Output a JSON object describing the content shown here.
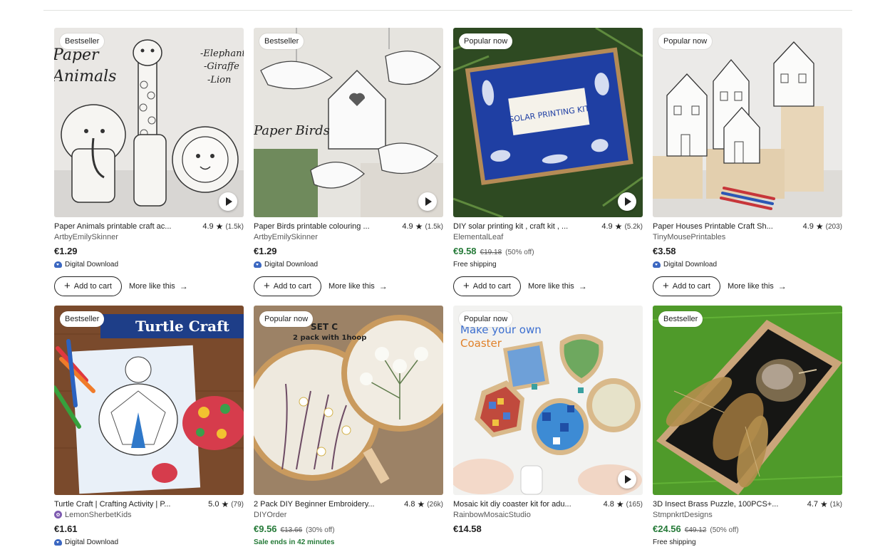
{
  "listings": [
    {
      "badge": "Bestseller",
      "title": "Paper Animals printable craft ac...",
      "rating": "4.9",
      "reviews": "(1.5k)",
      "shop": "ArtbyEmilySkinner",
      "price": "€1.29",
      "original_price": "",
      "discount": "",
      "note": "Digital Download",
      "image_text": [
        "Paper",
        "Animals",
        "-Elephant",
        "-Giraffe",
        "-Lion"
      ]
    },
    {
      "badge": "Bestseller",
      "title": "Paper Birds printable colouring ...",
      "rating": "4.9",
      "reviews": "(1.5k)",
      "shop": "ArtbyEmilySkinner",
      "price": "€1.29",
      "original_price": "",
      "discount": "",
      "note": "Digital Download",
      "image_text": [
        "Paper Birds"
      ]
    },
    {
      "badge": "Popular now",
      "title": "DIY solar printing kit , craft kit , ...",
      "rating": "4.9",
      "reviews": "(5.2k)",
      "shop": "ElementalLeaf",
      "price": "€9.58",
      "original_price": "€19.18",
      "discount": "(50% off)",
      "note": "Free shipping",
      "image_text": [
        "SOLAR PRINTING KIT"
      ]
    },
    {
      "badge": "Popular now",
      "title": "Paper Houses Printable Craft Sh...",
      "rating": "4.9",
      "reviews": "(203)",
      "shop": "TinyMousePrintables",
      "price": "€3.58",
      "original_price": "",
      "discount": "",
      "note": "Digital Download",
      "image_text": []
    },
    {
      "badge": "Bestseller",
      "title": "Turtle Craft | Crafting Activity | P...",
      "rating": "5.0",
      "reviews": "(79)",
      "shop": "LemonSherbetKids",
      "price": "€1.61",
      "original_price": "",
      "discount": "",
      "note": "Digital Download",
      "image_text": [
        "Turtle Craft"
      ]
    },
    {
      "badge": "Popular now",
      "title": "2 Pack DIY Beginner Embroidery...",
      "rating": "4.8",
      "reviews": "(26k)",
      "shop": "DIYOrder",
      "price": "€9.56",
      "original_price": "€13.66",
      "discount": "(30% off)",
      "note": "Sale ends in 42 minutes",
      "image_text": [
        "SET C",
        "2 pack with 1hoop"
      ]
    },
    {
      "badge": "Popular now",
      "title": "Mosaic kit diy coaster kit for adu...",
      "rating": "4.8",
      "reviews": "(165)",
      "shop": "RainbowMosaicStudio",
      "price": "€14.58",
      "original_price": "",
      "discount": "",
      "note": "",
      "image_text": [
        "Make your own",
        "Coaster"
      ]
    },
    {
      "badge": "Bestseller",
      "title": "3D Insect Brass Puzzle, 100PCS+...",
      "rating": "4.7",
      "reviews": "(1k)",
      "shop": "StmpnkrtDesigns",
      "price": "€24.56",
      "original_price": "€49.12",
      "discount": "(50% off)",
      "note": "Free shipping",
      "image_text": []
    }
  ],
  "buttons": {
    "add_to_cart": "Add to cart",
    "more_like_this": "More like this"
  },
  "colors": {
    "sale_green": "#257a38",
    "text": "#222222",
    "muted": "#595959",
    "download_blue": "#3b67c1"
  }
}
